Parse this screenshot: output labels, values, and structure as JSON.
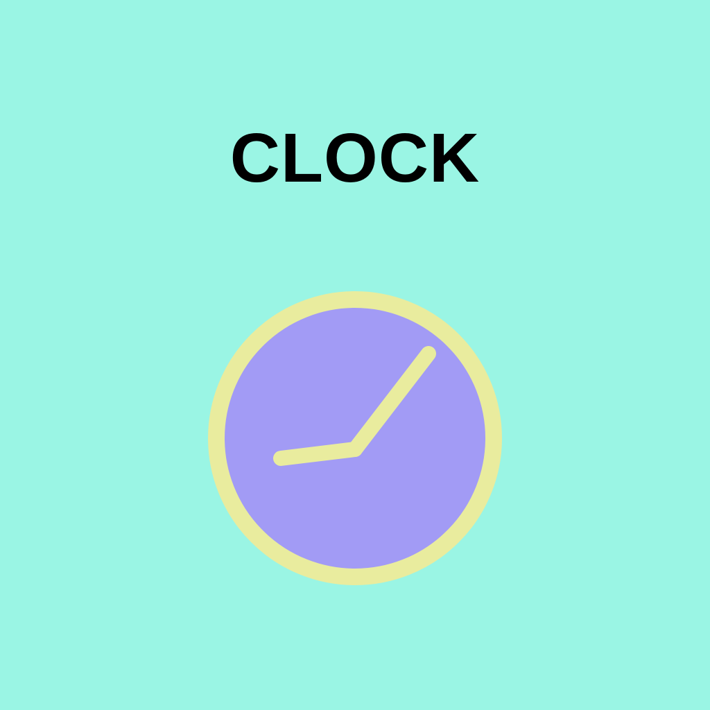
{
  "title": "CLOCK",
  "colors": {
    "background": "#9af5e4",
    "title_text": "#000000",
    "clock_rim": "#e9ec9e",
    "clock_face": "#a29bf5",
    "clock_hands": "#e9ec9e"
  },
  "icon": "clock-icon",
  "clock": {
    "time_shown": "1:41"
  }
}
